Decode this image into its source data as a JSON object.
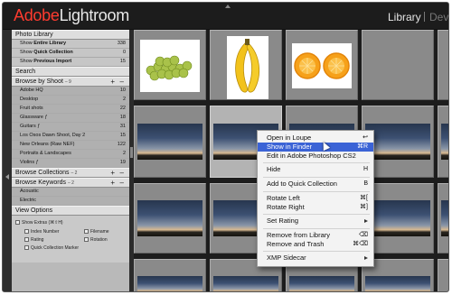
{
  "topbar": {
    "logo_brand": "Adobe",
    "logo_product": "Lightroom",
    "module_active": "Library",
    "module_next": "Dev"
  },
  "left_panel": {
    "photo_library": {
      "title": "Photo Library",
      "rows": [
        {
          "prefix": "Show",
          "label": "Entire Library",
          "count": "338"
        },
        {
          "prefix": "Show",
          "label": "Quick Collection",
          "count": "0"
        },
        {
          "prefix": "Show",
          "label": "Previous Import",
          "count": "15"
        }
      ]
    },
    "search": {
      "title": "Search"
    },
    "browse_by_shoot": {
      "title": "Browse by Shoot",
      "count": "– 9",
      "items": [
        {
          "label": "Adobe HQ",
          "count": "10"
        },
        {
          "label": "Desktop",
          "count": "2"
        },
        {
          "label": "Fruit shots",
          "count": "22"
        },
        {
          "label": "Glassware ƒ",
          "count": "18"
        },
        {
          "label": "Guitars ƒ",
          "count": "31"
        },
        {
          "label": "Los Osos Dawn Shoot, Day 2",
          "count": "15"
        },
        {
          "label": "New Orleans (Raw NEF)",
          "count": "122"
        },
        {
          "label": "Portraits & Landscapes",
          "count": "2"
        },
        {
          "label": "Violins ƒ",
          "count": "19"
        }
      ]
    },
    "browse_collections": {
      "title": "Browse Collections",
      "count": "– 2"
    },
    "browse_keywords": {
      "title": "Browse Keywords",
      "count": "– 2",
      "items": [
        {
          "label": "Acoustic"
        },
        {
          "label": "Electric"
        }
      ]
    },
    "view_options": {
      "title": "View Options",
      "show_extras": "Show Extras",
      "shortcut": "(⌘⇧H)",
      "index_number": "Index Number",
      "filename": "Filename",
      "rating": "Rating",
      "rotation": "Rotation",
      "quick_collection_marker": "Quick Collection Marker"
    }
  },
  "context_menu": {
    "items": [
      {
        "label": "Open in Loupe",
        "shortcut": "↩"
      },
      {
        "label": "Show in Finder",
        "shortcut": "⌘R"
      },
      {
        "label": "Edit in Adobe Photoshop CS2",
        "shortcut": ""
      },
      {
        "label": "Hide",
        "shortcut": "H"
      },
      {
        "label": "Add to Quick Collection",
        "shortcut": "B"
      },
      {
        "label": "Rotate Left",
        "shortcut": "⌘["
      },
      {
        "label": "Rotate Right",
        "shortcut": "⌘]"
      },
      {
        "label": "Set Rating",
        "shortcut": ""
      },
      {
        "label": "Remove from Library",
        "shortcut": "⌫"
      },
      {
        "label": "Remove and Trash",
        "shortcut": "⌘⌫"
      },
      {
        "label": "XMP Sidecar",
        "shortcut": ""
      }
    ]
  },
  "colors": {
    "logo_brand": "#ff3b2f",
    "menu_highlight": "#3b63d6",
    "panel_bg": "#b9b9b9",
    "grid_bg": "#1d1d1d"
  }
}
